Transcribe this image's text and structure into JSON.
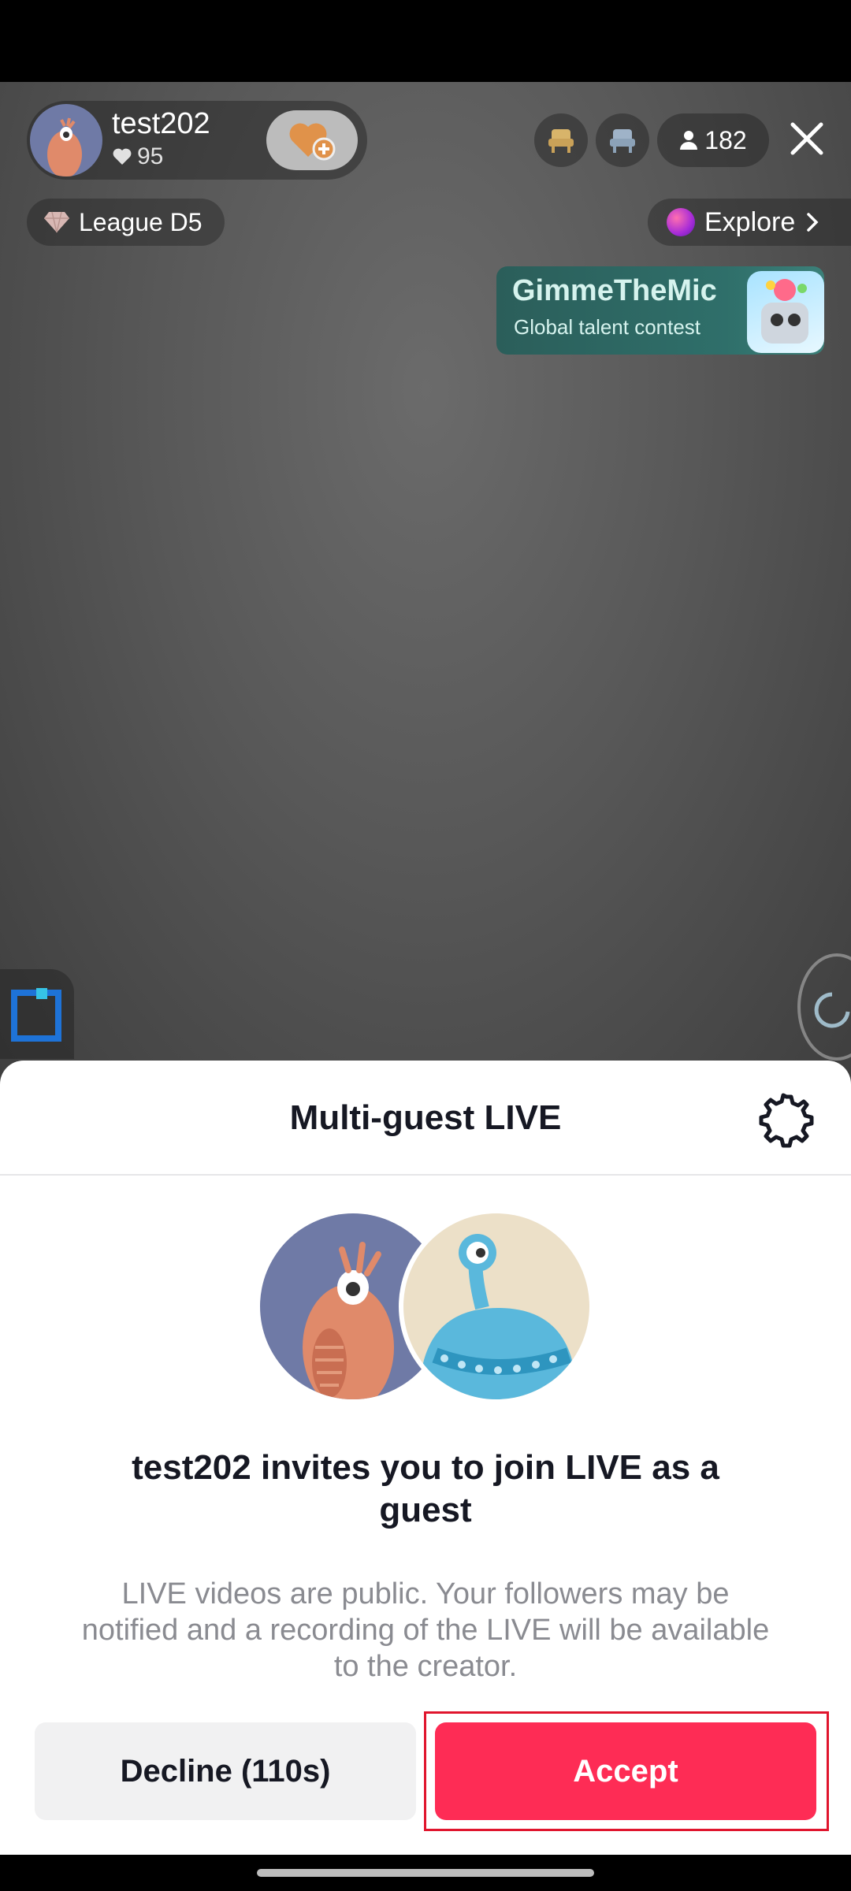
{
  "host": {
    "name": "test202",
    "likes": "95"
  },
  "top_bar": {
    "viewer_count": "182"
  },
  "league": {
    "label": "League D5"
  },
  "explore": {
    "label": "Explore"
  },
  "banner": {
    "title": "GimmeTheMic",
    "subtitle": "Global talent contest"
  },
  "sheet": {
    "title": "Multi-guest LIVE",
    "invite_title": "test202 invites you to join LIVE as a guest",
    "invite_description": "LIVE videos are public. Your followers may be notified and a recording of the LIVE will be available to the creator.",
    "decline_label": "Decline (110s)",
    "accept_label": "Accept"
  },
  "colors": {
    "accent": "#fe2c55",
    "highlight_outline": "#e0152d"
  }
}
